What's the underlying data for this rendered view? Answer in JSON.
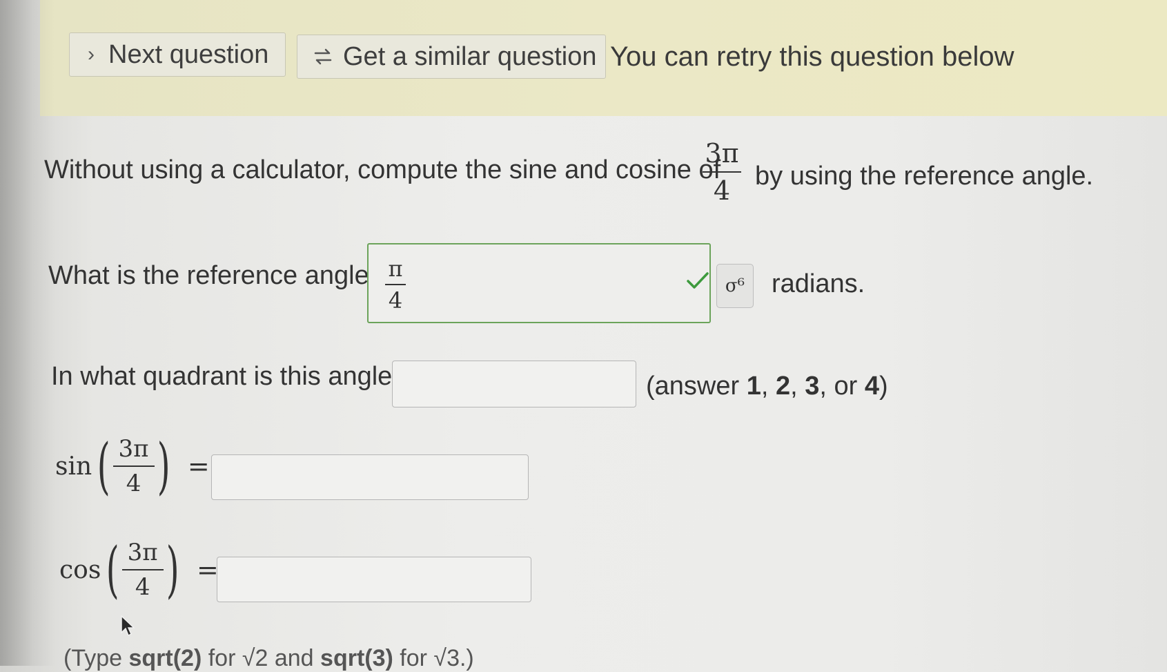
{
  "toolbar": {
    "next_label": "Next question",
    "similar_label": "Get a similar question",
    "retry_text": "You can retry this question below"
  },
  "question": {
    "intro": "Without using a calculator, compute the sine and cosine of",
    "angle_num": "3π",
    "angle_den": "4",
    "tail": "by using the reference angle."
  },
  "reference": {
    "label": "What is the reference angle?",
    "answer_num": "π",
    "answer_den": "4",
    "status": "correct",
    "symbol_button": "σ⁶",
    "unit": "radians."
  },
  "quadrant": {
    "label": "In what quadrant is this angle?",
    "value": "",
    "hint_open": "(answer ",
    "opt1": "1",
    "sep1": ", ",
    "opt2": "2",
    "sep2": ", ",
    "opt3": "3",
    "sep3": ", or ",
    "opt4": "4",
    "hint_close": ")"
  },
  "sin_row": {
    "fn": "sin",
    "num": "3π",
    "den": "4",
    "eq": "=",
    "value": ""
  },
  "cos_row": {
    "fn": "cos",
    "num": "3π",
    "den": "4",
    "eq": "=",
    "value": ""
  },
  "footer": {
    "pre": "(Type ",
    "code1": "sqrt(2)",
    "mid": " for √2 and ",
    "code2": "sqrt(3)",
    "post": " for √3.)"
  },
  "colors": {
    "banner": "#ebe8c6",
    "correct_border": "#6ba35a",
    "check": "#3d9a3d"
  }
}
